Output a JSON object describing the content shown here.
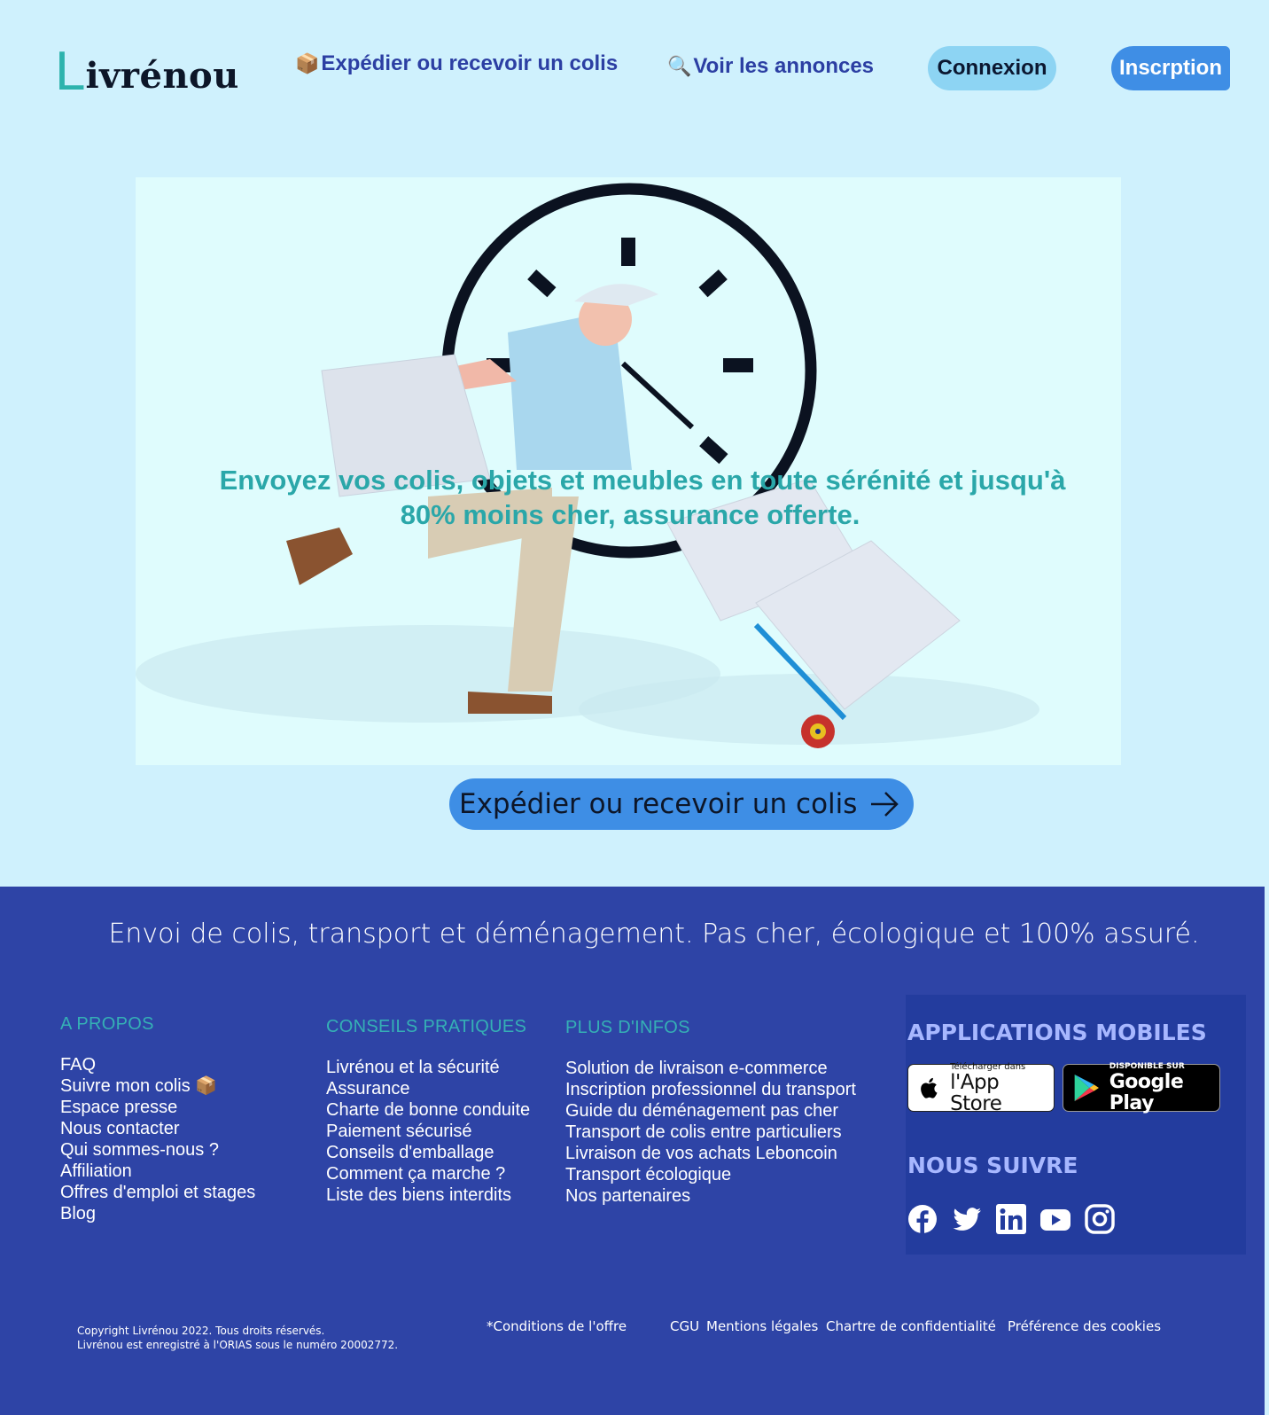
{
  "header": {
    "logo_initial": "L",
    "logo_rest": "ivrénou",
    "nav": [
      {
        "icon": "package-icon",
        "glyph": "📦",
        "label": "Expédier ou recevoir un colis"
      },
      {
        "icon": "magnifier-icon",
        "glyph": "🔍",
        "label": "Voir les annonces"
      }
    ],
    "login_label": "Connexion",
    "signup_label": "Inscrption"
  },
  "hero": {
    "headline_line1": "Envoyez vos colis, objets et meubles en toute sérénité et jusqu'à",
    "headline_line2": "80% moins cher, assurance offerte.",
    "cta_label": "Expédier ou recevoir un colis"
  },
  "footer": {
    "tagline": "Envoi de colis, transport et déménagement. Pas cher, écologique et 100% assuré.",
    "columns": [
      {
        "title": "A PROPOS",
        "items": [
          "FAQ",
          "Suivre mon colis 📦",
          "Espace presse",
          "Nous contacter",
          "Qui sommes-nous ?",
          "Affiliation",
          "Offres d'emploi et stages",
          "Blog"
        ]
      },
      {
        "title": "CONSEILS PRATIQUES",
        "items": [
          "Livrénou et la sécurité",
          "Assurance",
          "Charte de bonne conduite",
          "Paiement sécurisé",
          "Conseils d'emballage",
          "Comment ça marche ?",
          "Liste des biens interdits"
        ]
      },
      {
        "title": "PLUS D'INFOS",
        "items": [
          "Solution de livraison e-commerce",
          "Inscription professionnel du transport",
          "Guide du déménagement pas cher",
          "Transport de colis entre particuliers",
          "Livraison de vos achats Leboncoin",
          "Transport écologique",
          "Nos partenaires"
        ]
      }
    ],
    "apps_title": "APPLICATIONS MOBILES",
    "appstore_small": "Télécharger dans",
    "appstore_name": "l'App Store",
    "gplay_small": "DISPONIBLE SUR",
    "gplay_name": "Google Play",
    "follow_title": "NOUS SUIVRE",
    "socials": [
      "facebook-icon",
      "twitter-icon",
      "linkedin-icon",
      "youtube-icon",
      "instagram-icon"
    ],
    "copyright_1": "Copyright Livrénou 2022. Tous droits réservés.",
    "copyright_2": "Livrénou est enregistré à l'ORIAS sous le numéro 20002772.",
    "legal_offer": "*Conditions de l'offre",
    "legal_cgu": "CGU",
    "legal_mentions": "Mentions légales",
    "legal_privacy": "Chartre de confidentialité",
    "legal_cookies": "Préférence des cookies"
  },
  "colors": {
    "page_bg": "#cff1fd",
    "brand_teal": "#2db3ad",
    "nav_blue": "#2c3fa3",
    "button_blue": "#3e8ee5",
    "footer_bg": "#2e44a6"
  }
}
